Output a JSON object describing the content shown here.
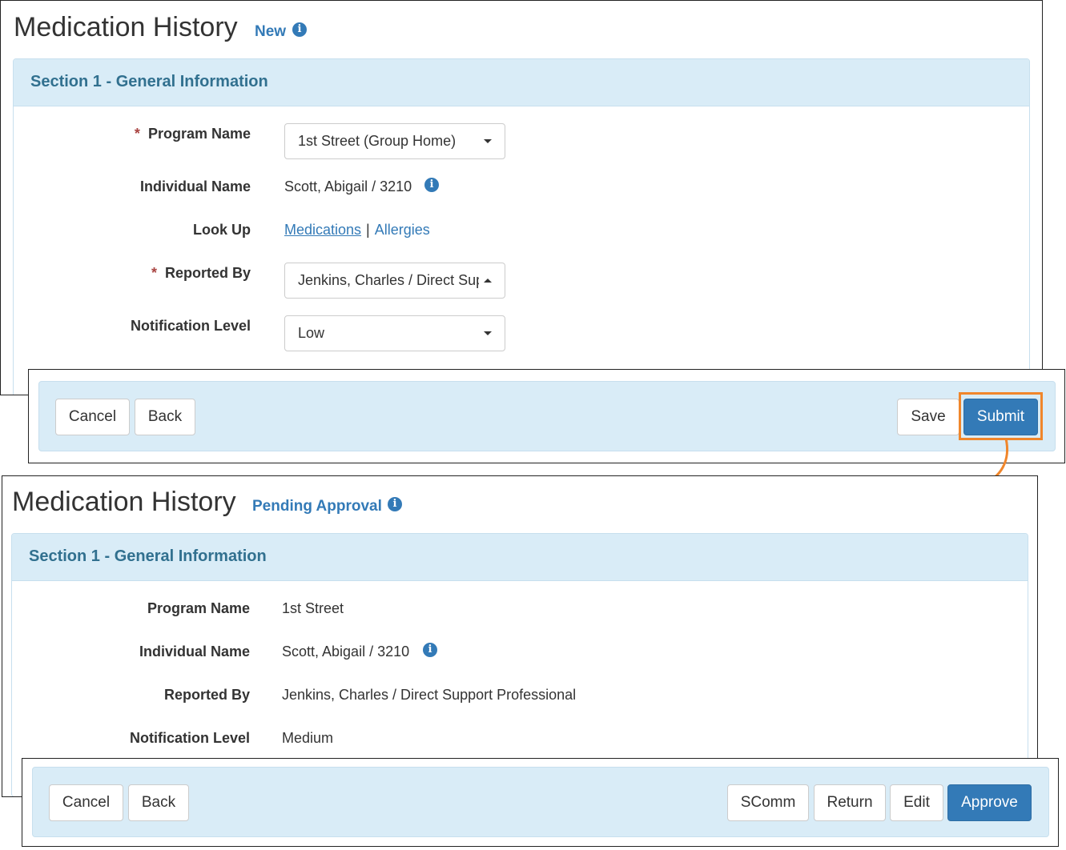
{
  "colors": {
    "accent": "#337ab7",
    "section_header_bg": "#d9ecf7",
    "required": "#a94442",
    "highlight": "#f0862b"
  },
  "before": {
    "title": "Medication History",
    "status": "New",
    "section_title": "Section 1 - General Information",
    "fields": {
      "program_name": {
        "label": "Program Name",
        "required": true,
        "value": "1st Street (Group Home)"
      },
      "individual_name": {
        "label": "Individual Name",
        "value": "Scott, Abigail / 3210"
      },
      "look_up": {
        "label": "Look Up",
        "link1": "Medications",
        "separator": "|",
        "link2": "Allergies"
      },
      "reported_by": {
        "label": "Reported By",
        "required": true,
        "value": "Jenkins, Charles / Direct Support Professional"
      },
      "notification_level": {
        "label": "Notification Level",
        "value": "Low"
      }
    },
    "required_marker": "*",
    "buttons": {
      "cancel": "Cancel",
      "back": "Back",
      "save": "Save",
      "submit": "Submit"
    }
  },
  "after": {
    "title": "Medication History",
    "status": "Pending Approval",
    "section_title": "Section 1 - General Information",
    "fields": {
      "program_name": {
        "label": "Program Name",
        "value": "1st Street"
      },
      "individual_name": {
        "label": "Individual Name",
        "value": "Scott, Abigail / 3210"
      },
      "reported_by": {
        "label": "Reported By",
        "value": "Jenkins, Charles / Direct Support Professional"
      },
      "notification_level": {
        "label": "Notification Level",
        "value": "Medium"
      }
    },
    "buttons": {
      "cancel": "Cancel",
      "back": "Back",
      "scomm": "SComm",
      "return": "Return",
      "edit": "Edit",
      "approve": "Approve"
    }
  },
  "icons": {
    "info": "info-circle-icon",
    "dropdown": "caret-down-icon",
    "arrow": "curved-arrow-icon"
  }
}
